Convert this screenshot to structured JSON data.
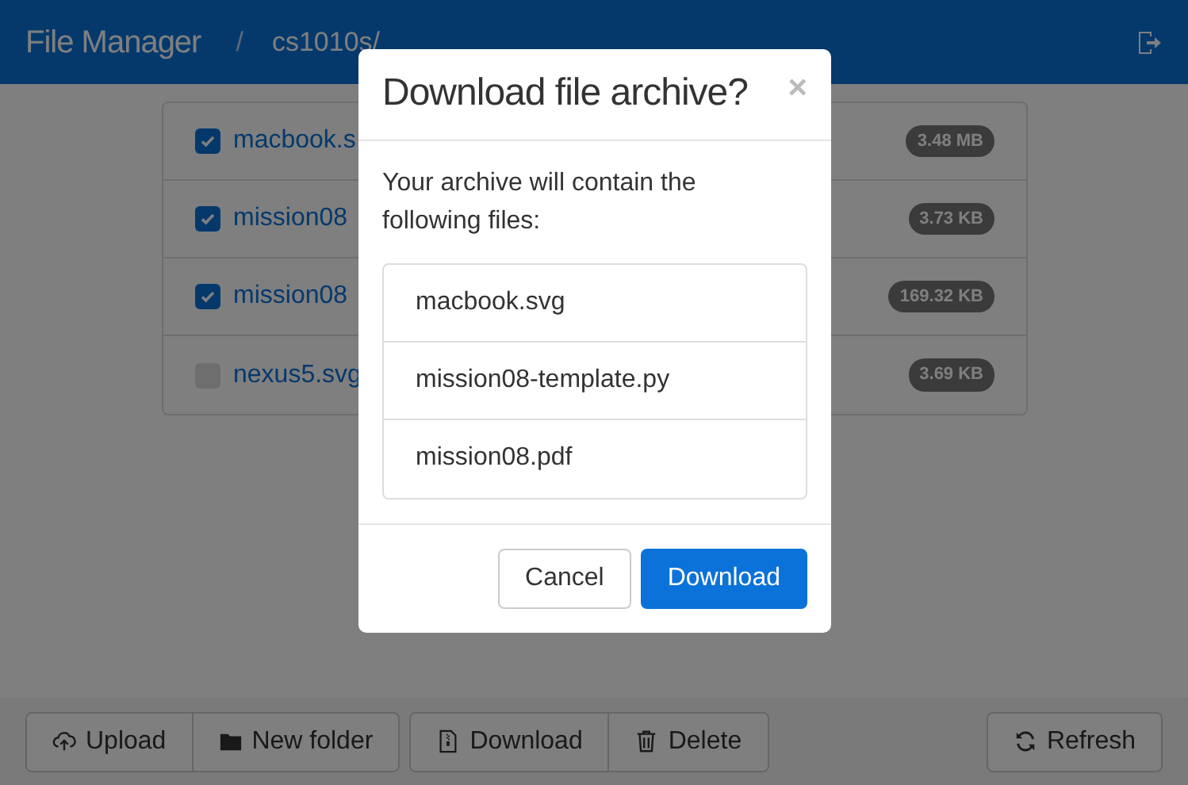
{
  "navbar": {
    "title": "File Manager",
    "separator": "/",
    "path": "cs1010s/"
  },
  "files": [
    {
      "name": "macbook.s",
      "checked": true,
      "size": "3.48 MB"
    },
    {
      "name": "mission08",
      "checked": true,
      "size": "3.73 KB"
    },
    {
      "name": "mission08",
      "checked": true,
      "size": "169.32 KB"
    },
    {
      "name": "nexus5.svg",
      "checked": false,
      "size": "3.69 KB"
    }
  ],
  "toolbar": {
    "groups": [
      [
        {
          "label": "Upload"
        },
        {
          "label": "New folder"
        }
      ],
      [
        {
          "label": "Download"
        },
        {
          "label": "Delete"
        }
      ]
    ],
    "refresh": {
      "label": "Refresh"
    }
  },
  "modal": {
    "title": "Download file archive?",
    "close": "×",
    "message": "Your archive will contain the following files:",
    "files": [
      "macbook.svg",
      "mission08-template.py",
      "mission08.pdf"
    ],
    "buttons": [
      {
        "label": "Cancel",
        "kind": "secondary"
      },
      {
        "label": "Download",
        "kind": "primary"
      }
    ]
  }
}
